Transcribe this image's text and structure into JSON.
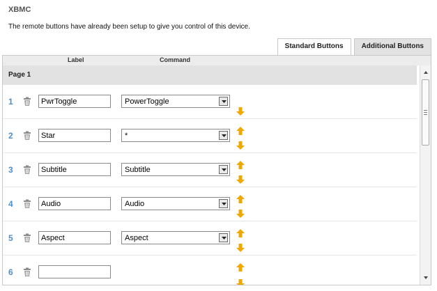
{
  "app": {
    "title": "XBMC"
  },
  "intro": {
    "text": "The remote buttons have already been setup to give you control of this device."
  },
  "tabs": [
    {
      "label": "Standard Buttons",
      "active": false
    },
    {
      "label": "Additional Buttons",
      "active": true
    }
  ],
  "columns": {
    "label": "Label",
    "command": "Command"
  },
  "page": {
    "title": "Page 1"
  },
  "rows": [
    {
      "number": "1",
      "label": "PwrToggle",
      "command": "PowerToggle"
    },
    {
      "number": "2",
      "label": "Star",
      "command": "*"
    },
    {
      "number": "3",
      "label": "Subtitle",
      "command": "Subtitle"
    },
    {
      "number": "4",
      "label": "Audio",
      "command": "Audio"
    },
    {
      "number": "5",
      "label": "Aspect",
      "command": "Aspect"
    },
    {
      "number": "6",
      "label": "",
      "command": ""
    }
  ],
  "colors": {
    "row_number": "#4a8fcf",
    "arrow": "#f0a800",
    "active_tab": "#e2e2e2"
  }
}
